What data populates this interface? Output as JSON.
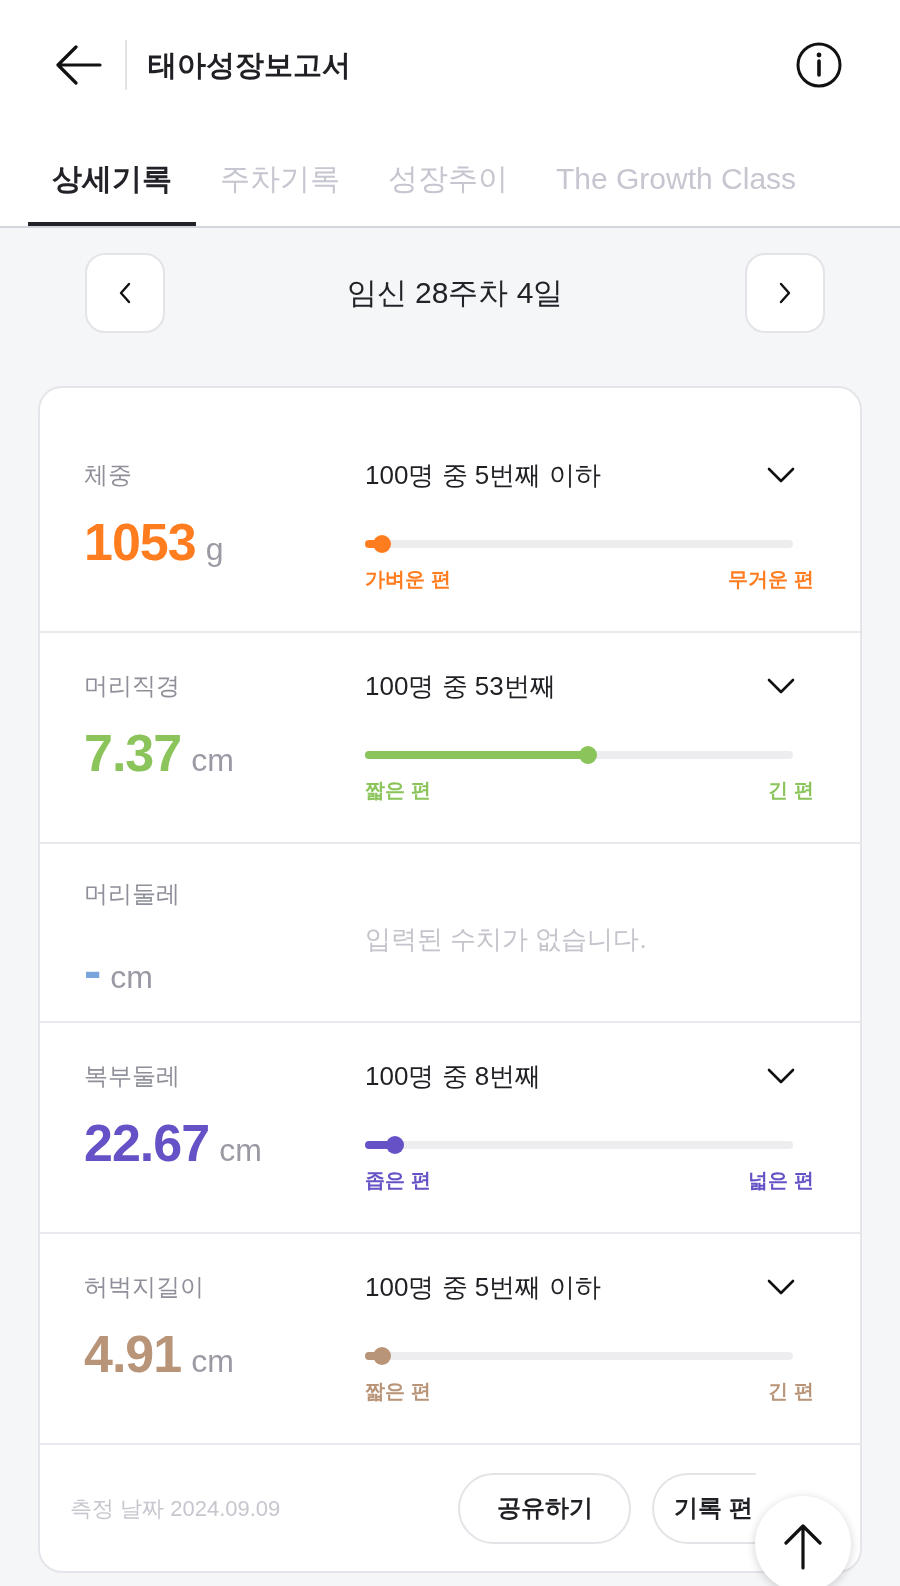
{
  "header": {
    "title": "태아성장보고서"
  },
  "tabs": [
    {
      "label": "상세기록",
      "selected": true
    },
    {
      "label": "주차기록",
      "selected": false
    },
    {
      "label": "성장추이",
      "selected": false
    },
    {
      "label": "The Growth Class",
      "selected": false
    }
  ],
  "date_nav": {
    "title": "임신 28주차 4일"
  },
  "measurements": [
    {
      "kind": "ranked",
      "label": "체중",
      "value": "1053",
      "unit": "g",
      "color": "#ff7c1f",
      "rank": "100명 중 5번째 이하",
      "expanded": false,
      "level": 0.04,
      "low_label": "가벼운 편",
      "high_label": "무거운 편"
    },
    {
      "kind": "ranked",
      "label": "머리직경",
      "value": "7.37",
      "unit": "cm",
      "color": "#8bc45b",
      "rank": "100명 중 53번째",
      "expanded": false,
      "level": 0.52,
      "low_label": "짧은 편",
      "high_label": "긴 편"
    },
    {
      "kind": "empty",
      "label": "머리둘레",
      "value": "-",
      "unit": "cm",
      "color": "#7aa5dc",
      "message": "입력된 수치가 없습니다."
    },
    {
      "kind": "ranked",
      "label": "복부둘레",
      "value": "22.67",
      "unit": "cm",
      "color": "#6652c6",
      "rank": "100명 중 8번째",
      "expanded": false,
      "level": 0.07,
      "low_label": "좁은 편",
      "high_label": "넓은 편"
    },
    {
      "kind": "ranked",
      "label": "허벅지길이",
      "value": "4.91",
      "unit": "cm",
      "color": "#b89478",
      "rank": "100명 중 5번째 이하",
      "expanded": false,
      "level": 0.04,
      "low_label": "짧은 편",
      "high_label": "긴 편"
    }
  ],
  "footer": {
    "date": "측정 날짜 2024.09.09",
    "buttons": [
      "공유하기",
      "기록 편"
    ]
  }
}
